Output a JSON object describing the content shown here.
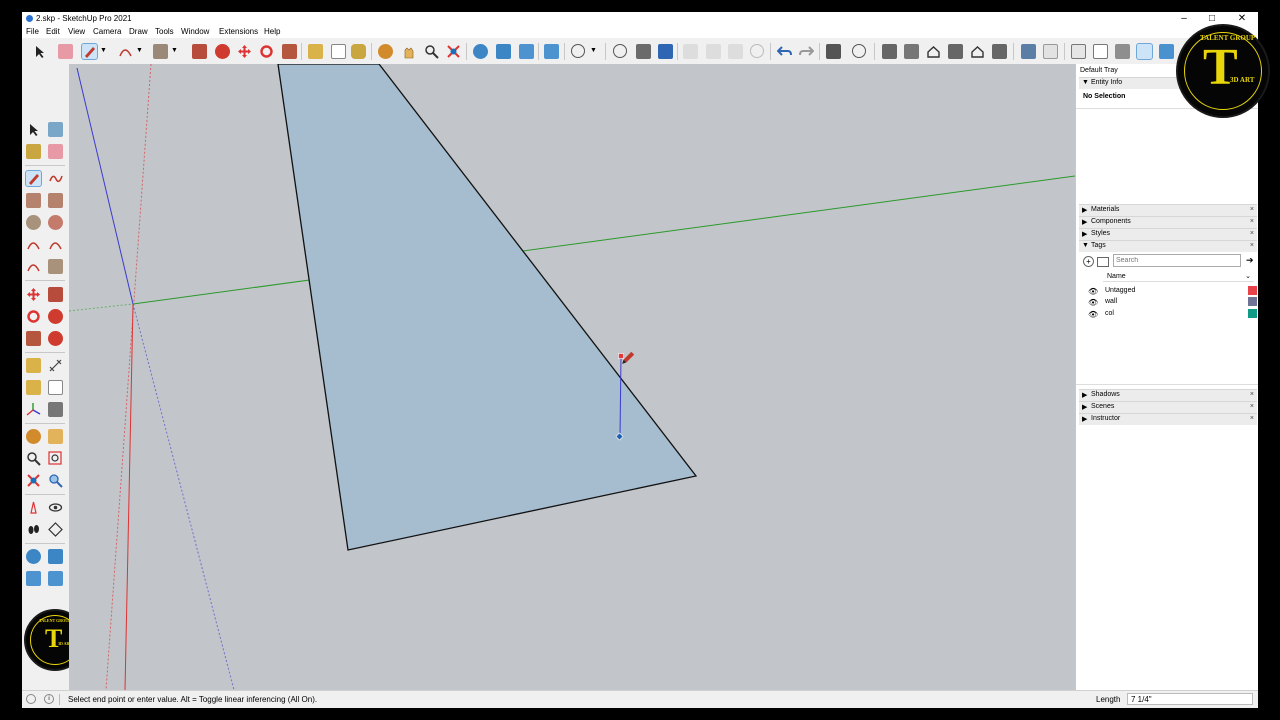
{
  "window": {
    "title": "2.skp - SketchUp Pro 2021",
    "controls": {
      "minimize": "–",
      "maximize": "□",
      "close": "✕"
    }
  },
  "menu": [
    "File",
    "Edit",
    "View",
    "Camera",
    "Draw",
    "Tools",
    "Window",
    "Extensions",
    "Help"
  ],
  "toolbar_icons": [
    "select-icon",
    "eraser-icon",
    "pencil-icon",
    "arc-icon",
    "rectangle-icon",
    "push-pull-icon",
    "follow-me-icon",
    "move-icon",
    "rotate-icon",
    "scale-icon",
    "tape-measure-icon",
    "text-icon",
    "paint-bucket-icon",
    "orbit-icon",
    "pan-icon",
    "zoom-icon",
    "zoom-extents-icon",
    "section-plane-icon",
    "section-display-icon",
    "section-fill-icon",
    "section-cut-icon",
    "user-icon",
    "add-location-icon",
    "3d-warehouse-icon",
    "save-icon",
    "cut-icon",
    "copy-icon",
    "paste-icon",
    "erase-icon",
    "undo-icon",
    "redo-icon",
    "print-icon",
    "model-info-icon",
    "iso-view-icon",
    "top-view-icon",
    "front-view-icon",
    "right-view-icon",
    "back-view-icon",
    "left-view-icon",
    "xray-icon",
    "back-edges-icon",
    "wireframe-icon",
    "hidden-line-icon",
    "shaded-icon",
    "shaded-textures-icon",
    "monochrome-icon"
  ],
  "tray": {
    "title": "Default Tray",
    "entity_info": {
      "label": "Entity Info",
      "value": "No Selection"
    },
    "panels": [
      "Materials",
      "Components",
      "Styles",
      "Tags"
    ],
    "tags": {
      "search_placeholder": "Search",
      "column_name": "Name",
      "items": [
        {
          "name": "Untagged",
          "color": "#e8434a"
        },
        {
          "name": "wall",
          "color": "#6f7396"
        },
        {
          "name": "col",
          "color": "#0f9b86"
        }
      ]
    },
    "lower_panels": [
      "Shadows",
      "Scenes",
      "Instructor"
    ]
  },
  "status": {
    "message": "Select end point or enter value. Alt = Toggle linear inferencing (All On).",
    "measurement_label": "Length",
    "measurement_value": "7 1/4\""
  },
  "logo": {
    "top_text": "TALENT GROUP",
    "bottom_text": "3D ART",
    "small_top_text": "TALENT GROUP"
  },
  "colors": {
    "face": "#a6bccf",
    "red_axis": "#d33",
    "green_axis": "#2a9a2a",
    "blue_axis": "#3b3bd0",
    "logo_gold": "#e8d60a"
  }
}
